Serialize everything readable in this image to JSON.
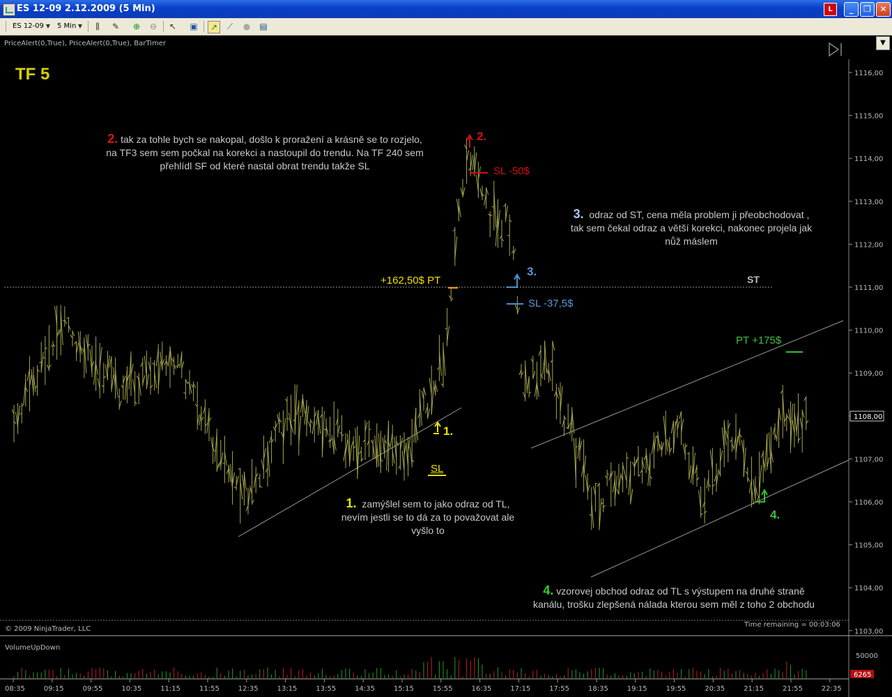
{
  "window": {
    "title": "ES 12-09  2.12.2009 (5 Min)",
    "buttons": [
      "L",
      "_",
      "❐",
      "✕"
    ]
  },
  "toolbar": {
    "instrument": "ES 12-09",
    "interval": "5 Min"
  },
  "chart": {
    "indicators_label": "PriceAlert(0,True), PriceAlert(0,True), BarTimer",
    "timeframe_label": "TF 5",
    "copyright": "© 2009 NinjaTrader, LLC",
    "time_remaining": "Time remaining = 00:03:06",
    "volume_panel_label": "VolumeUpDown",
    "price_axis": [
      "1116,00",
      "1115,00",
      "1114,00",
      "1113,00",
      "1112,00",
      "1111,00",
      "1110,00",
      "1109,00",
      "1108,00",
      "1107,00",
      "1106,00",
      "1105,00",
      "1104,00",
      "1103,00"
    ],
    "current_price": "1108,00",
    "volume_axis": "50000",
    "volume_current": "6265",
    "time_axis": [
      "08:35",
      "09:15",
      "09:55",
      "10:35",
      "11:15",
      "11:55",
      "12:35",
      "13:15",
      "13:55",
      "14:35",
      "15:15",
      "15:55",
      "16:35",
      "17:15",
      "17:55",
      "18:35",
      "19:15",
      "19:55",
      "20:35",
      "21:15",
      "21:55",
      "22:35"
    ],
    "st_label": "ST",
    "annotations": {
      "a1_num": "1.",
      "a1_text": "zamýšlel sem to jako odraz od TL,",
      "a1_text2": "nevím jestli se to dá za to považovat ale",
      "a1_text3": "vyšlo to",
      "a2_num": "2.",
      "a2_text": "tak za tohle bych se nakopal, došlo k proražení a krásně se to rozjelo,",
      "a2_text2": "na TF3 sem sem počkal na korekci a nastoupil do trendu. Na TF 240 sem",
      "a2_text3": "přehlídl SF od které nastal obrat trendu takže SL",
      "a3_num": "3.",
      "a3_text": "odraz od ST, cena měla problem ji přeobchodovat ,",
      "a3_text2": "tak sem čekal odraz a větší korekci, nakonec projela jak",
      "a3_text3": "nůž máslem",
      "a4_num": "4.",
      "a4_text": "vzorovej obchod odraz od TL s výstupem na druhé straně",
      "a4_text2": "kanálu, trošku zlepšená nálada kterou sem měl z toho 2 obchodu"
    },
    "labels": {
      "pt1": "+162,50$  PT",
      "sl1": "SL",
      "m1": "1.",
      "m2": "2.",
      "sl2": "SL -50$",
      "m3": "3.",
      "sl3": "SL -37,5$",
      "pt4": "PT +175$",
      "m4": "4."
    },
    "colors": {
      "bars": "#a8a850",
      "trade1": "#e8e800",
      "trade2": "#d01010",
      "trade3": "#4a90d0",
      "trade4": "#30c030"
    }
  }
}
